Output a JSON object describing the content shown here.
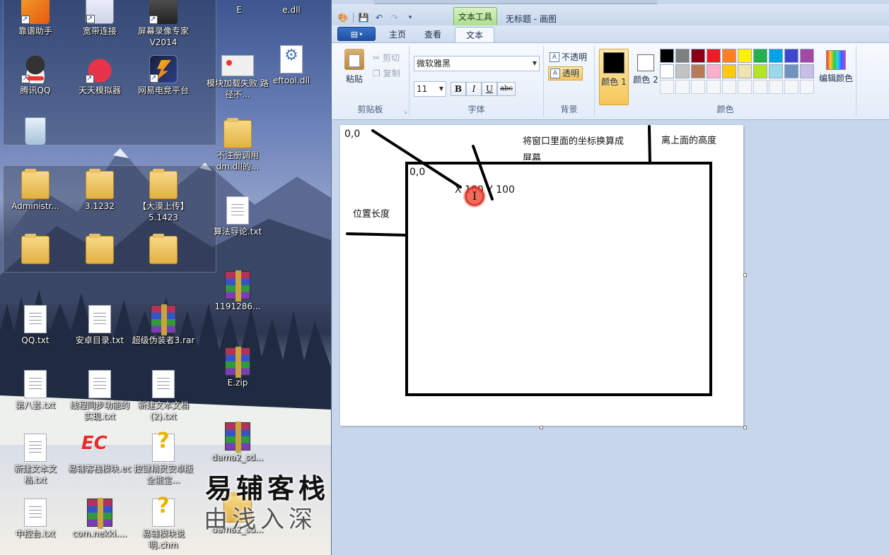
{
  "desktop": {
    "icons": [
      {
        "label": "靠谱助手"
      },
      {
        "label": "宽带连接"
      },
      {
        "label": "屏幕录像专家V2014"
      },
      {
        "label": "腾讯QQ"
      },
      {
        "label": "天天模拟器"
      },
      {
        "label": "网易电竞平台"
      },
      {
        "label": ""
      },
      {
        "label": "Administr..."
      },
      {
        "label": "3.1232"
      },
      {
        "label": "【大漠上传】5.1423"
      },
      {
        "label": ""
      },
      {
        "label": ""
      },
      {
        "label": ""
      },
      {
        "label": "QQ.txt"
      },
      {
        "label": "安卓目录.txt"
      },
      {
        "label": "超级伪装者3.rar"
      },
      {
        "label": "第八套.txt"
      },
      {
        "label": "线程同步功能的实现.txt"
      },
      {
        "label": "新建文本文档 (2).txt"
      },
      {
        "label": "新建文本文档.txt"
      },
      {
        "label": "易辅客栈模块.ec"
      },
      {
        "label": "按键精灵安卓版全能宝..."
      },
      {
        "label": "中控台.txt"
      },
      {
        "label": "com.nekki...."
      },
      {
        "label": "易辅模块说明.chm"
      },
      {
        "label": "E"
      },
      {
        "label": "e.dll"
      },
      {
        "label": "模块加载失败 路径不..."
      },
      {
        "label": "eftool.dll"
      },
      {
        "label": "不注册调用dm.dll的..."
      },
      {
        "label": "算法导论.txt"
      },
      {
        "label": "1191286..."
      },
      {
        "label": "E.zip"
      },
      {
        "label": "dama2_sd..."
      },
      {
        "label": "dama2_sd..."
      }
    ],
    "watermark": {
      "line1": "易辅客栈",
      "line2": "由浅入深"
    }
  },
  "paint": {
    "context_tab": "文本工具",
    "window_title": "无标题 - 画图",
    "tabs": {
      "home": "主页",
      "view": "查看",
      "text": "文本"
    },
    "clipboard": {
      "paste": "粘贴",
      "cut": "剪切",
      "copy": "复制",
      "label": "剪贴板"
    },
    "font": {
      "family": "微软雅黑",
      "size": "11",
      "bold": "B",
      "italic": "I",
      "underline": "U",
      "strike": "abc",
      "label": "字体"
    },
    "background": {
      "opaque": "不透明",
      "transparent": "透明",
      "label": "背景"
    },
    "colors": {
      "color1": "颜色 1",
      "color2": "颜色 2",
      "edit": "编辑颜色",
      "label": "颜色",
      "color1_value": "#000000",
      "color2_value": "#ffffff",
      "palette": [
        "#000000",
        "#7f7f7f",
        "#880015",
        "#ed1c24",
        "#ff7f27",
        "#fff200",
        "#22b14c",
        "#00a2e8",
        "#3f48cc",
        "#a349a4",
        "#ffffff",
        "#c3c3c3",
        "#b97a57",
        "#ffaec9",
        "#ffc90e",
        "#efe4b0",
        "#b5e61d",
        "#99d9ea",
        "#7092be",
        "#c8bfe7"
      ]
    },
    "canvas": {
      "origin_outer": "0,0",
      "origin_inner": "0,0",
      "note_convert": "将窗口里面的坐标换算成屏幕",
      "note_top": "离上面的高度",
      "note_left": "位置长度",
      "coord_text": "X 100  Y 100"
    }
  }
}
